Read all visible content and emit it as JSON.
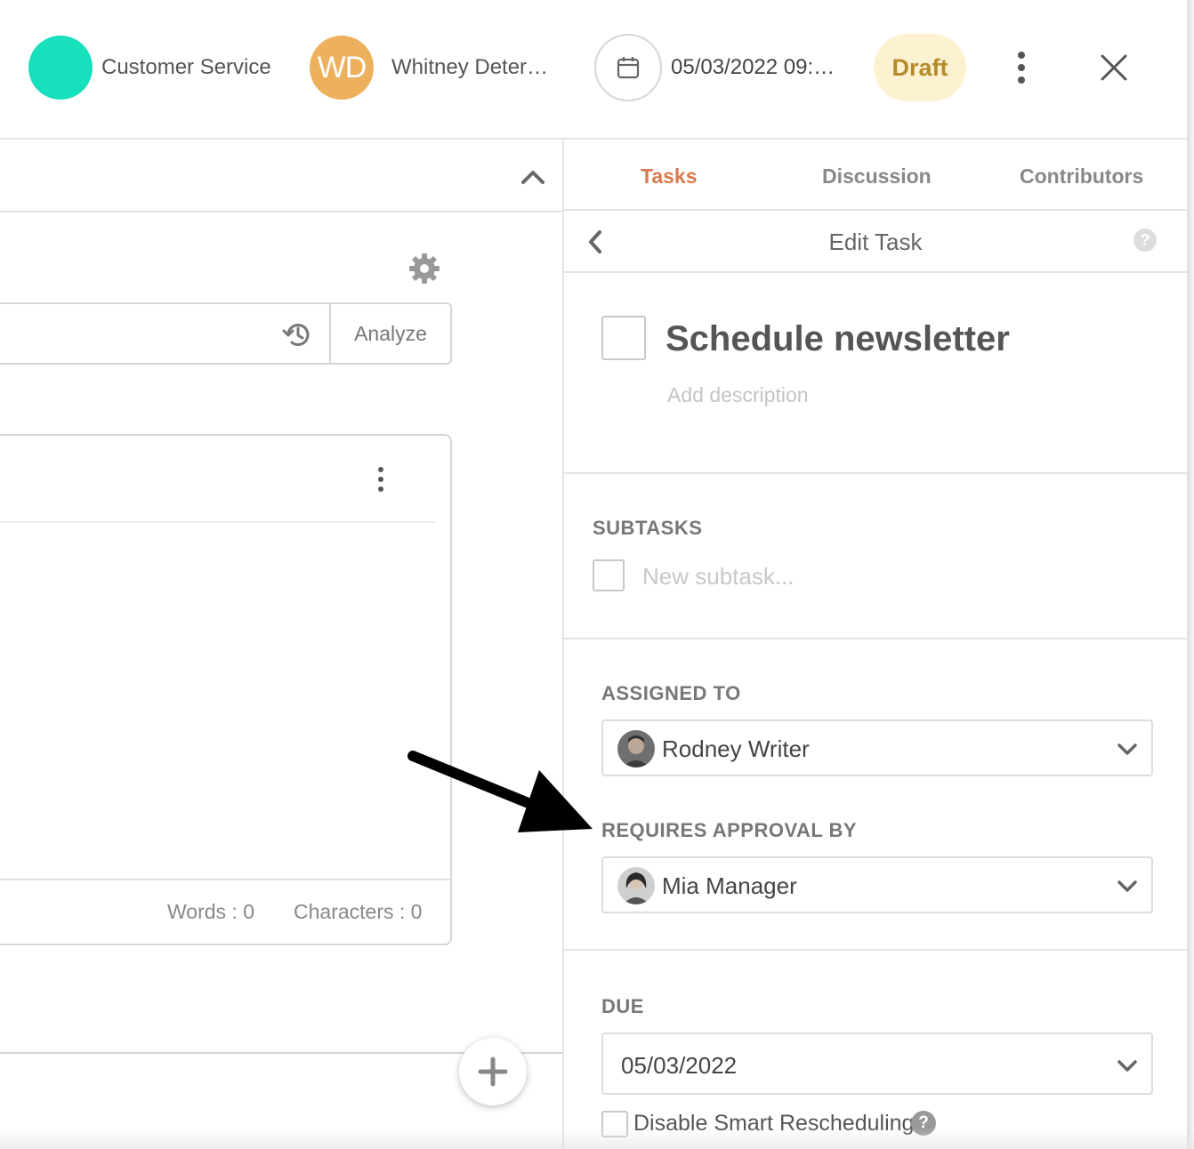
{
  "header": {
    "channel": {
      "name": "Customer Service",
      "color": "#17e0bd"
    },
    "owner": {
      "initials": "WD",
      "name": "Whitney Deter…",
      "color": "#edb05d"
    },
    "date": {
      "icon": "calendar-icon",
      "text": "05/03/2022 09:…"
    },
    "status": "Draft",
    "more_icon": "vertical-dots-icon",
    "close_icon": "close-icon"
  },
  "editor": {
    "analyze_label": "Analyze",
    "words_label": "Words : 0",
    "characters_label": "Characters : 0",
    "fab_icon": "plus-icon"
  },
  "panel": {
    "tabs": [
      {
        "label": "Tasks",
        "active": true
      },
      {
        "label": "Discussion",
        "active": false
      },
      {
        "label": "Contributors",
        "active": false
      }
    ],
    "edit_title": "Edit Task",
    "help_symbol": "?",
    "task": {
      "title": "Schedule newsletter",
      "description_placeholder": "Add description"
    },
    "subtasks": {
      "label": "SUBTASKS",
      "placeholder": "New subtask..."
    },
    "assigned": {
      "label": "ASSIGNED TO",
      "value": "Rodney Writer"
    },
    "approval": {
      "label": "REQUIRES APPROVAL BY",
      "value": "Mia Manager"
    },
    "due": {
      "label": "DUE",
      "value": "05/03/2022"
    },
    "smart_rescheduling": {
      "label": "Disable Smart Rescheduling",
      "checked": false,
      "help_symbol": "?"
    }
  },
  "colors": {
    "accent_tab": "#d87b4f",
    "draft_bg": "#fcf2d2",
    "draft_text": "#b58a2c"
  }
}
